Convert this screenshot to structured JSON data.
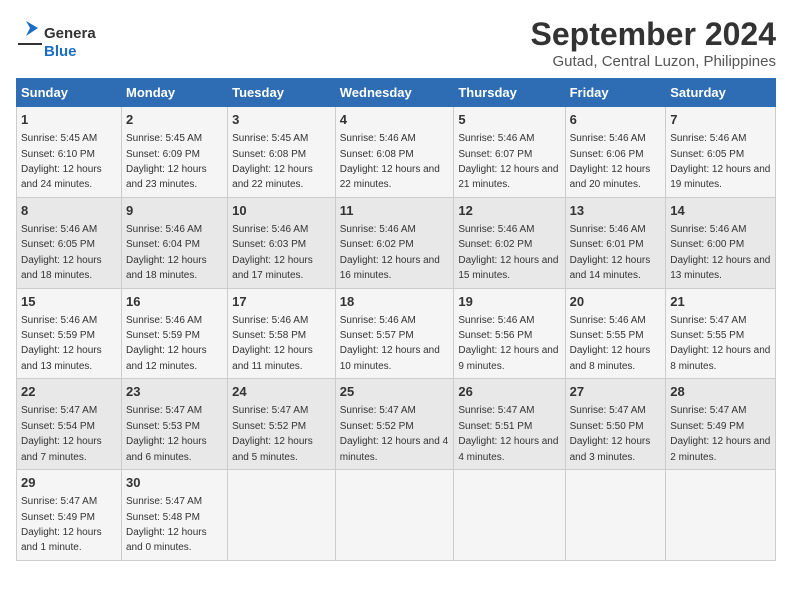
{
  "header": {
    "logo_general": "General",
    "logo_blue": "Blue",
    "title": "September 2024",
    "subtitle": "Gutad, Central Luzon, Philippines"
  },
  "calendar": {
    "days_of_week": [
      "Sunday",
      "Monday",
      "Tuesday",
      "Wednesday",
      "Thursday",
      "Friday",
      "Saturday"
    ],
    "weeks": [
      [
        null,
        {
          "day": "2",
          "sunrise": "Sunrise: 5:45 AM",
          "sunset": "Sunset: 6:09 PM",
          "daylight": "Daylight: 12 hours and 23 minutes."
        },
        {
          "day": "3",
          "sunrise": "Sunrise: 5:45 AM",
          "sunset": "Sunset: 6:08 PM",
          "daylight": "Daylight: 12 hours and 22 minutes."
        },
        {
          "day": "4",
          "sunrise": "Sunrise: 5:46 AM",
          "sunset": "Sunset: 6:08 PM",
          "daylight": "Daylight: 12 hours and 22 minutes."
        },
        {
          "day": "5",
          "sunrise": "Sunrise: 5:46 AM",
          "sunset": "Sunset: 6:07 PM",
          "daylight": "Daylight: 12 hours and 21 minutes."
        },
        {
          "day": "6",
          "sunrise": "Sunrise: 5:46 AM",
          "sunset": "Sunset: 6:06 PM",
          "daylight": "Daylight: 12 hours and 20 minutes."
        },
        {
          "day": "7",
          "sunrise": "Sunrise: 5:46 AM",
          "sunset": "Sunset: 6:05 PM",
          "daylight": "Daylight: 12 hours and 19 minutes."
        }
      ],
      [
        {
          "day": "1",
          "sunrise": "Sunrise: 5:45 AM",
          "sunset": "Sunset: 6:10 PM",
          "daylight": "Daylight: 12 hours and 24 minutes."
        },
        {
          "day": "9",
          "sunrise": "Sunrise: 5:46 AM",
          "sunset": "Sunset: 6:04 PM",
          "daylight": "Daylight: 12 hours and 18 minutes."
        },
        {
          "day": "10",
          "sunrise": "Sunrise: 5:46 AM",
          "sunset": "Sunset: 6:03 PM",
          "daylight": "Daylight: 12 hours and 17 minutes."
        },
        {
          "day": "11",
          "sunrise": "Sunrise: 5:46 AM",
          "sunset": "Sunset: 6:02 PM",
          "daylight": "Daylight: 12 hours and 16 minutes."
        },
        {
          "day": "12",
          "sunrise": "Sunrise: 5:46 AM",
          "sunset": "Sunset: 6:02 PM",
          "daylight": "Daylight: 12 hours and 15 minutes."
        },
        {
          "day": "13",
          "sunrise": "Sunrise: 5:46 AM",
          "sunset": "Sunset: 6:01 PM",
          "daylight": "Daylight: 12 hours and 14 minutes."
        },
        {
          "day": "14",
          "sunrise": "Sunrise: 5:46 AM",
          "sunset": "Sunset: 6:00 PM",
          "daylight": "Daylight: 12 hours and 13 minutes."
        }
      ],
      [
        {
          "day": "8",
          "sunrise": "Sunrise: 5:46 AM",
          "sunset": "Sunset: 6:05 PM",
          "daylight": "Daylight: 12 hours and 18 minutes."
        },
        {
          "day": "16",
          "sunrise": "Sunrise: 5:46 AM",
          "sunset": "Sunset: 5:59 PM",
          "daylight": "Daylight: 12 hours and 12 minutes."
        },
        {
          "day": "17",
          "sunrise": "Sunrise: 5:46 AM",
          "sunset": "Sunset: 5:58 PM",
          "daylight": "Daylight: 12 hours and 11 minutes."
        },
        {
          "day": "18",
          "sunrise": "Sunrise: 5:46 AM",
          "sunset": "Sunset: 5:57 PM",
          "daylight": "Daylight: 12 hours and 10 minutes."
        },
        {
          "day": "19",
          "sunrise": "Sunrise: 5:46 AM",
          "sunset": "Sunset: 5:56 PM",
          "daylight": "Daylight: 12 hours and 9 minutes."
        },
        {
          "day": "20",
          "sunrise": "Sunrise: 5:46 AM",
          "sunset": "Sunset: 5:55 PM",
          "daylight": "Daylight: 12 hours and 8 minutes."
        },
        {
          "day": "21",
          "sunrise": "Sunrise: 5:47 AM",
          "sunset": "Sunset: 5:55 PM",
          "daylight": "Daylight: 12 hours and 8 minutes."
        }
      ],
      [
        {
          "day": "15",
          "sunrise": "Sunrise: 5:46 AM",
          "sunset": "Sunset: 5:59 PM",
          "daylight": "Daylight: 12 hours and 13 minutes."
        },
        {
          "day": "23",
          "sunrise": "Sunrise: 5:47 AM",
          "sunset": "Sunset: 5:53 PM",
          "daylight": "Daylight: 12 hours and 6 minutes."
        },
        {
          "day": "24",
          "sunrise": "Sunrise: 5:47 AM",
          "sunset": "Sunset: 5:52 PM",
          "daylight": "Daylight: 12 hours and 5 minutes."
        },
        {
          "day": "25",
          "sunrise": "Sunrise: 5:47 AM",
          "sunset": "Sunset: 5:52 PM",
          "daylight": "Daylight: 12 hours and 4 minutes."
        },
        {
          "day": "26",
          "sunrise": "Sunrise: 5:47 AM",
          "sunset": "Sunset: 5:51 PM",
          "daylight": "Daylight: 12 hours and 4 minutes."
        },
        {
          "day": "27",
          "sunrise": "Sunrise: 5:47 AM",
          "sunset": "Sunset: 5:50 PM",
          "daylight": "Daylight: 12 hours and 3 minutes."
        },
        {
          "day": "28",
          "sunrise": "Sunrise: 5:47 AM",
          "sunset": "Sunset: 5:49 PM",
          "daylight": "Daylight: 12 hours and 2 minutes."
        }
      ],
      [
        {
          "day": "22",
          "sunrise": "Sunrise: 5:47 AM",
          "sunset": "Sunset: 5:54 PM",
          "daylight": "Daylight: 12 hours and 7 minutes."
        },
        {
          "day": "30",
          "sunrise": "Sunrise: 5:47 AM",
          "sunset": "Sunset: 5:48 PM",
          "daylight": "Daylight: 12 hours and 0 minutes."
        },
        null,
        null,
        null,
        null,
        null
      ],
      [
        {
          "day": "29",
          "sunrise": "Sunrise: 5:47 AM",
          "sunset": "Sunset: 5:49 PM",
          "daylight": "Daylight: 12 hours and 1 minute."
        },
        null,
        null,
        null,
        null,
        null,
        null
      ]
    ],
    "week_first_days": [
      [
        null,
        "2",
        "3",
        "4",
        "5",
        "6",
        "7"
      ],
      [
        "1",
        "9",
        "10",
        "11",
        "12",
        "13",
        "14"
      ],
      [
        "8",
        "16",
        "17",
        "18",
        "19",
        "20",
        "21"
      ],
      [
        "15",
        "23",
        "24",
        "25",
        "26",
        "27",
        "28"
      ],
      [
        "22",
        "30",
        null,
        null,
        null,
        null,
        null
      ],
      [
        "29",
        null,
        null,
        null,
        null,
        null,
        null
      ]
    ]
  }
}
